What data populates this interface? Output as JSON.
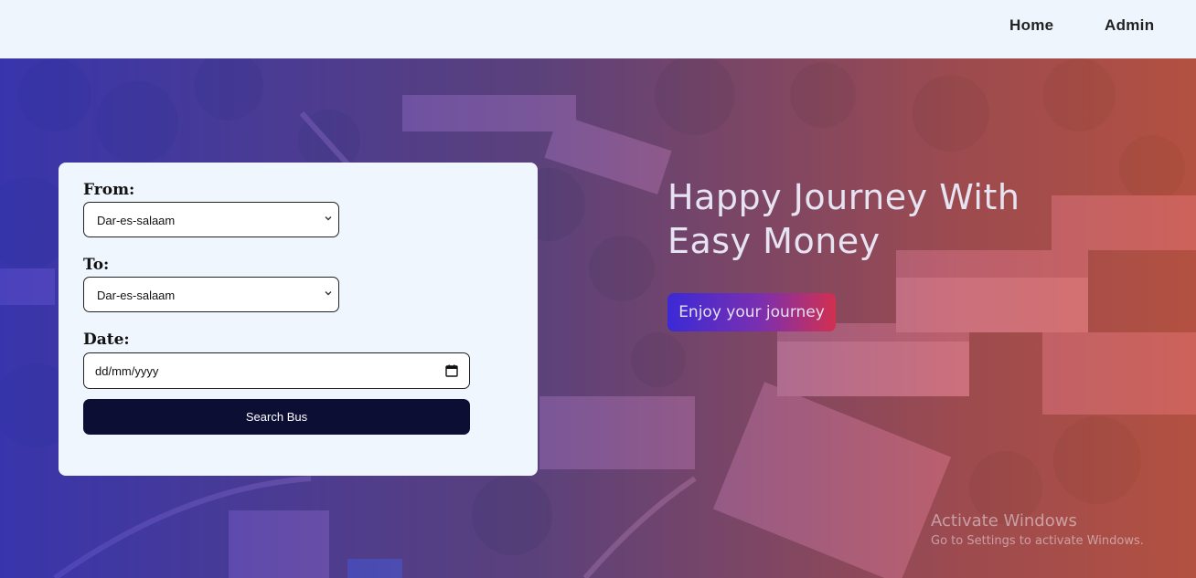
{
  "nav": {
    "home": "Home",
    "admin": "Admin"
  },
  "form": {
    "from_label": "From:",
    "from_value": "Dar-es-salaam",
    "to_label": "To:",
    "to_value": "Dar-es-salaam",
    "date_label": "Date:",
    "date_placeholder": "dd/mm/yyyy",
    "search_button": "Search Bus"
  },
  "hero": {
    "headline_line1": "Happy Journey With",
    "headline_line2": "Easy Money",
    "cta": "Enjoy your journey"
  },
  "watermark": {
    "title": "Activate Windows",
    "subtitle": "Go to Settings to activate Windows."
  },
  "icons": {
    "select_arrow": "chevron-down-icon",
    "date_picker": "calendar-icon"
  },
  "colors": {
    "search_button": "#0c0e34",
    "card_background": "#eff6fe",
    "navbar_background": "#eff5fc"
  }
}
